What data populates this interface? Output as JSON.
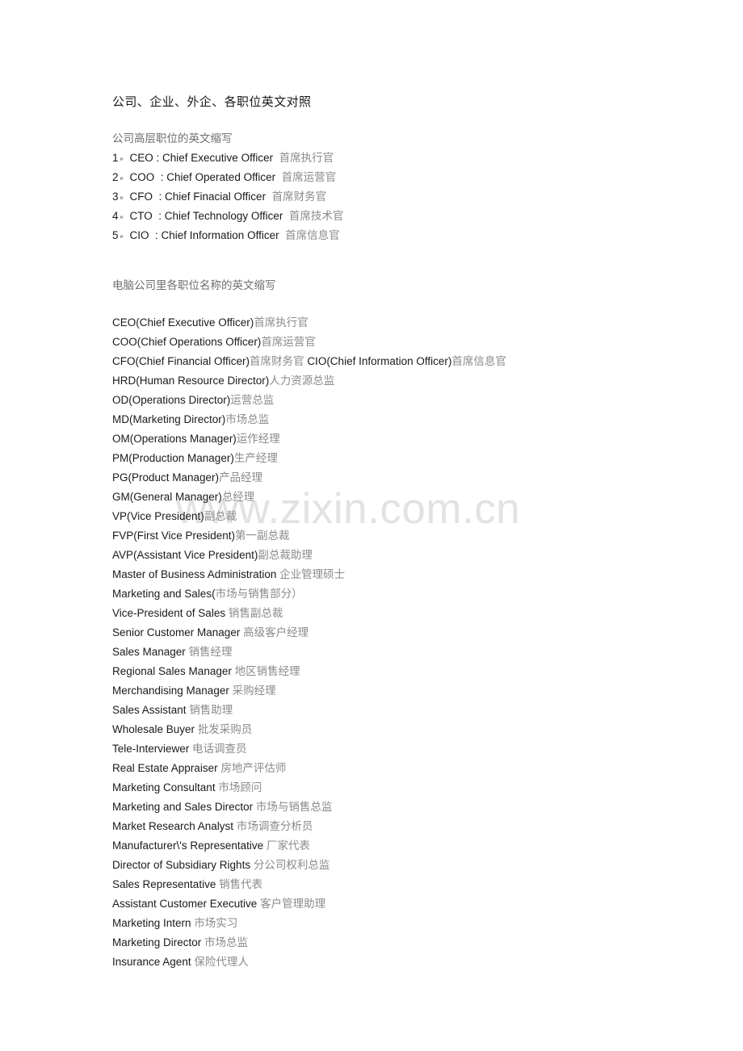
{
  "document": {
    "title": "公司、企业、外企、各职位英文对照",
    "watermark": "www.zixin.com.cn",
    "section1": {
      "heading": "公司高层职位的英文缩写",
      "items": [
        {
          "index": "1",
          "sep": "。",
          "en": "CEO : Chief Executive Officer",
          "zh": "首席执行官"
        },
        {
          "index": "2",
          "sep": "。",
          "en": "COO  : Chief Operated Officer",
          "zh": "首席运营官"
        },
        {
          "index": "3",
          "sep": "。",
          "en": "CFO  : Chief Finacial Officer",
          "zh": "首席财务官"
        },
        {
          "index": "4",
          "sep": "。",
          "en": "CTO  : Chief Technology Officer",
          "zh": "首席技术官"
        },
        {
          "index": "5",
          "sep": "。",
          "en": "CIO  : Chief Information Officer",
          "zh": "首席信息官"
        }
      ]
    },
    "section2": {
      "heading": "电脑公司里各职位名称的英文缩写",
      "items": [
        {
          "en": "CEO(Chief Executive Officer)",
          "zh": "首席执行官"
        },
        {
          "en": "COO(Chief Operations Officer)",
          "zh": "首席运营官"
        },
        {
          "en": "CFO(Chief Financial Officer)",
          "zh": "首席财务官 ",
          "en2": "CIO(Chief Information Officer)",
          "zh2": "首席信息官"
        },
        {
          "en": "HRD(Human Resource Director)",
          "zh": "人力资源总监"
        },
        {
          "en": "OD(Operations Director)",
          "zh": "运营总监"
        },
        {
          "en": "MD(Marketing Director)",
          "zh": "市场总监"
        },
        {
          "en": "OM(Operations Manager)",
          "zh": "运作经理"
        },
        {
          "en": "PM(Production Manager)",
          "zh": "生产经理"
        },
        {
          "en": "PG(Product Manager)",
          "zh": "产品经理"
        },
        {
          "en": "GM(General Manager)",
          "zh": "总经理"
        },
        {
          "en": "VP(Vice President)",
          "zh": "副总裁"
        },
        {
          "en": "FVP(First Vice President)",
          "zh": "第一副总裁"
        },
        {
          "en": "AVP(Assistant Vice President)",
          "zh": "副总裁助理"
        },
        {
          "en": "Master of Business Administration ",
          "zh": "企业管理硕士"
        },
        {
          "en": "Marketing and Sales(",
          "zh": "市场与销售部分）"
        },
        {
          "en": "Vice-President of Sales ",
          "zh": "销售副总裁"
        },
        {
          "en": "Senior Customer Manager ",
          "zh": "高级客户经理"
        },
        {
          "en": "Sales Manager ",
          "zh": "销售经理"
        },
        {
          "en": "Regional Sales Manager ",
          "zh": "地区销售经理"
        },
        {
          "en": "Merchandising Manager ",
          "zh": "采购经理"
        },
        {
          "en": "Sales Assistant ",
          "zh": "销售助理"
        },
        {
          "en": "Wholesale Buyer ",
          "zh": "批发采购员"
        },
        {
          "en": "Tele-Interviewer ",
          "zh": "电话调查员"
        },
        {
          "en": "Real Estate Appraiser ",
          "zh": "房地产评估师"
        },
        {
          "en": "Marketing Consultant ",
          "zh": "市场顾问"
        },
        {
          "en": "Marketing and Sales Director ",
          "zh": "市场与销售总监"
        },
        {
          "en": "Market Research Analyst ",
          "zh": "市场调查分析员"
        },
        {
          "en": "Manufacturer\\'s Representative ",
          "zh": "厂家代表"
        },
        {
          "en": "Director of Subsidiary Rights ",
          "zh": "分公司权利总监"
        },
        {
          "en": "Sales Representative ",
          "zh": "销售代表"
        },
        {
          "en": "Assistant Customer Executive ",
          "zh": "客户管理助理"
        },
        {
          "en": "Marketing Intern ",
          "zh": "市场实习"
        },
        {
          "en": "Marketing Director ",
          "zh": "市场总监"
        },
        {
          "en": "Insurance Agent ",
          "zh": "保险代理人"
        }
      ]
    }
  }
}
